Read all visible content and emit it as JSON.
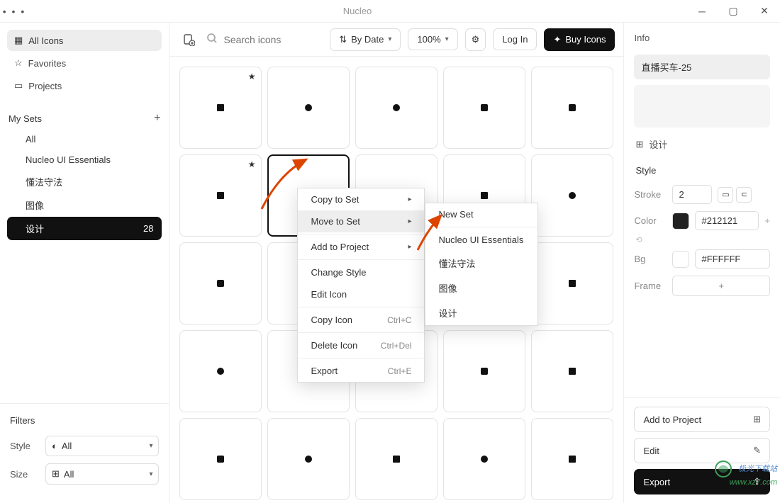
{
  "window": {
    "title": "Nucleo"
  },
  "sidebar": {
    "all_icons": "All Icons",
    "favorites": "Favorites",
    "projects": "Projects",
    "my_sets_title": "My Sets",
    "sets": [
      {
        "label": "All"
      },
      {
        "label": "Nucleo UI Essentials"
      },
      {
        "label": "懂法守法"
      },
      {
        "label": "图像"
      },
      {
        "label": "设计",
        "count": "28",
        "active": true
      }
    ]
  },
  "filters": {
    "title": "Filters",
    "style_label": "Style",
    "style_value": "All",
    "size_label": "Size",
    "size_value": "All"
  },
  "toolbar": {
    "search_placeholder": "Search icons",
    "sort_label": "By Date",
    "zoom": "100%",
    "login": "Log In",
    "buy": "Buy Icons"
  },
  "context_menu": {
    "copy_to_set": "Copy to Set",
    "move_to_set": "Move to Set",
    "add_to_project": "Add to Project",
    "change_style": "Change Style",
    "edit_icon": "Edit Icon",
    "copy_icon": "Copy Icon",
    "copy_icon_sc": "Ctrl+C",
    "delete_icon": "Delete Icon",
    "delete_icon_sc": "Ctrl+Del",
    "export": "Export",
    "export_sc": "Ctrl+E"
  },
  "submenu": {
    "new_set": "New Set",
    "items": [
      "Nucleo UI Essentials",
      "懂法守法",
      "图像",
      "设计"
    ]
  },
  "info_panel": {
    "title": "Info",
    "icon_name": "直播买车-25",
    "tree_label": "设计",
    "style_title": "Style",
    "stroke_label": "Stroke",
    "stroke_value": "2",
    "color_label": "Color",
    "color_value": "#212121",
    "bg_label": "Bg",
    "bg_value": "#FFFFFF",
    "frame_label": "Frame",
    "add_to_project": "Add to Project",
    "edit": "Edit",
    "export": "Export"
  },
  "watermark": {
    "line1": "极光下载站",
    "line2": "www.xz7.com"
  }
}
